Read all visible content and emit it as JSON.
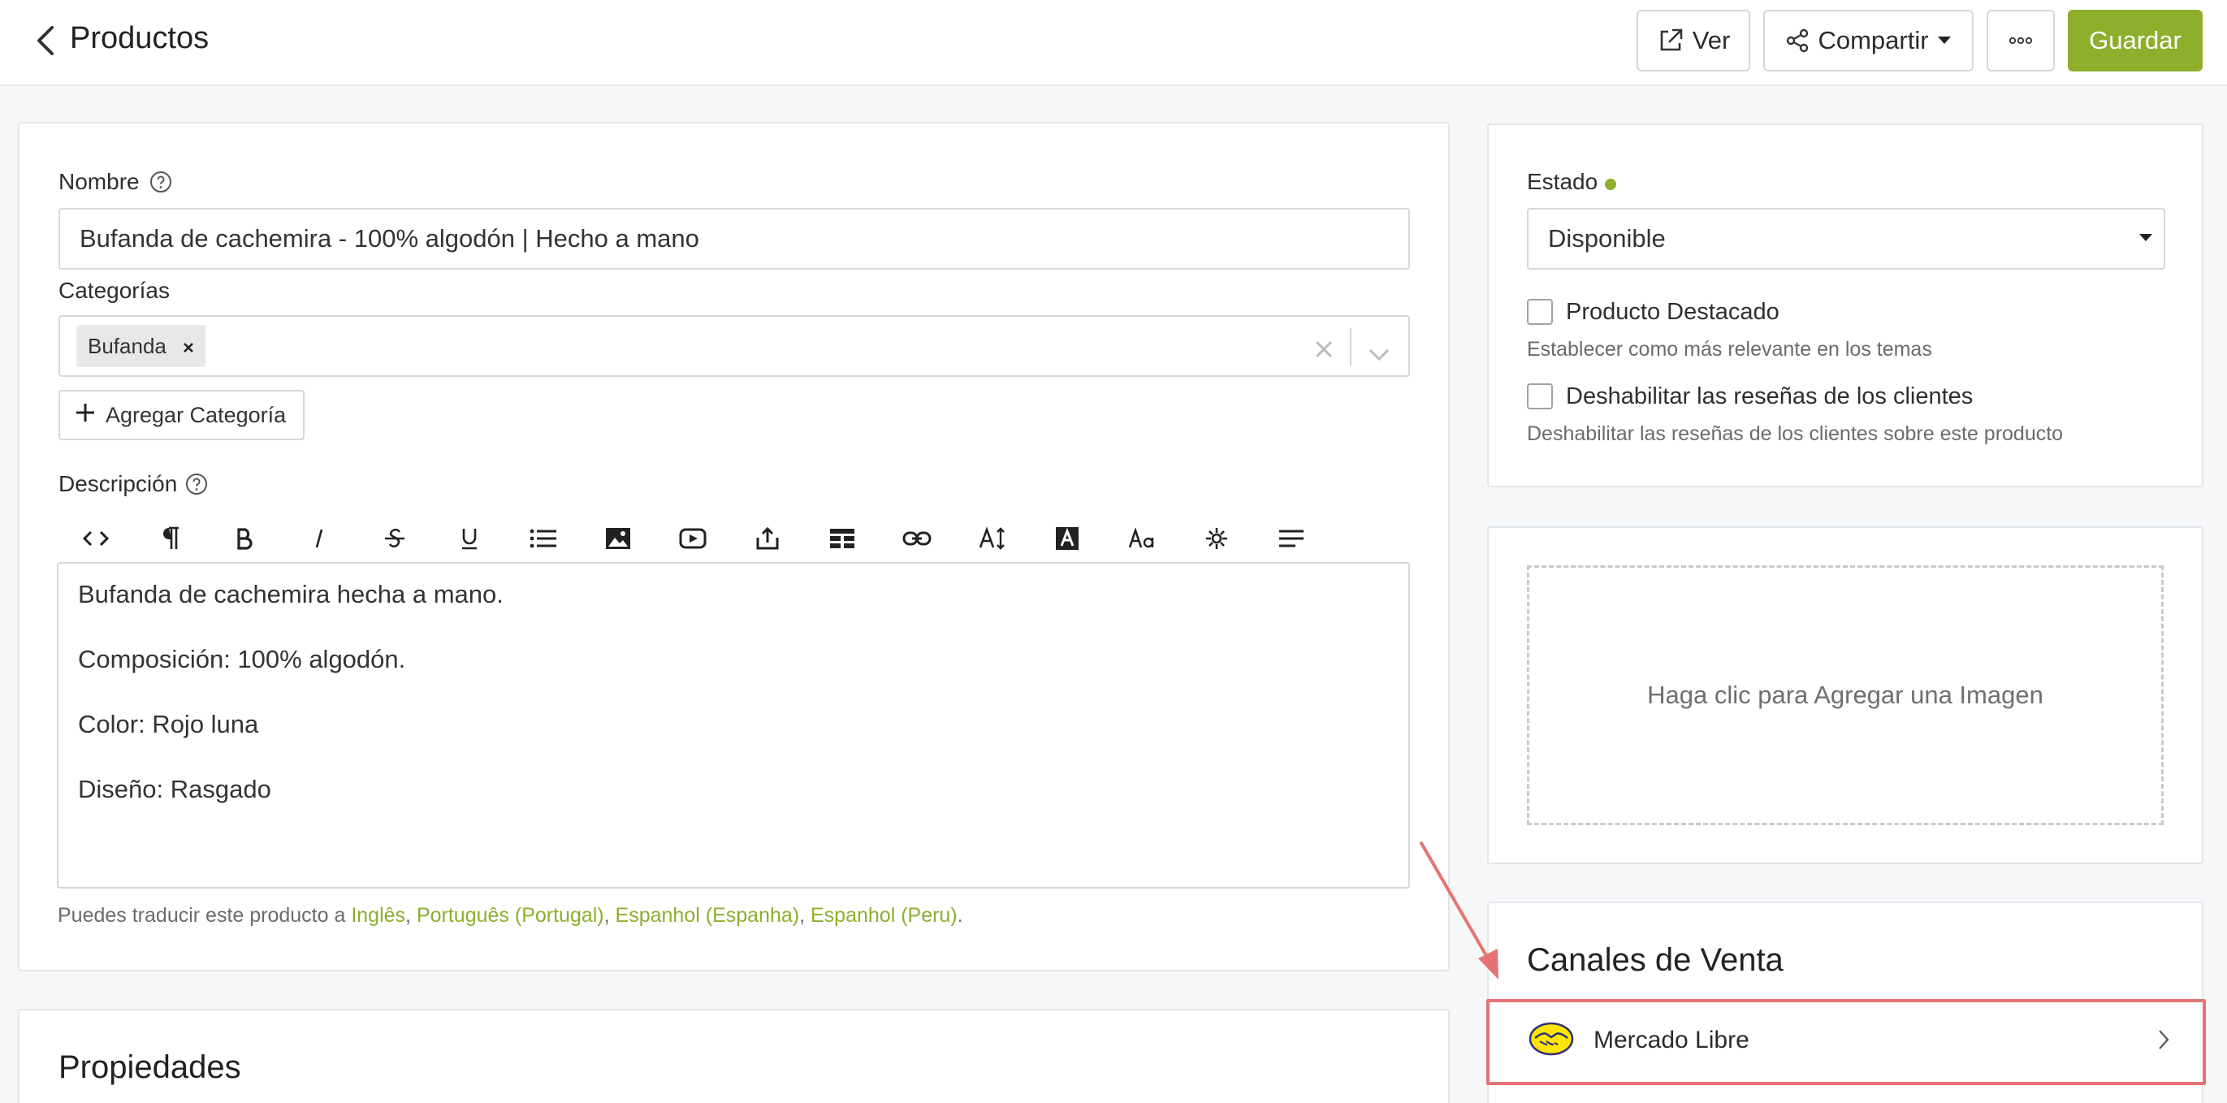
{
  "header": {
    "title": "Productos",
    "buttons": {
      "view": "Ver",
      "share": "Compartir",
      "save": "Guardar"
    }
  },
  "form": {
    "name_label": "Nombre",
    "name_value": "Bufanda de cachemira - 100% algodón | Hecho a mano",
    "categories_label": "Categorías",
    "categories": [
      "Bufanda"
    ],
    "add_category_label": "Agregar Categoría",
    "description_label": "Descripción",
    "description_lines": [
      "Bufanda de cachemira hecha a mano.",
      "Composición: 100% algodón.",
      "Color: Rojo luna",
      "Diseño: Rasgado"
    ],
    "translate_prefix": "Puedes traducir este producto a ",
    "translate_links": [
      "Inglês",
      "Português (Portugal)",
      "Espanhol (Espanha)",
      "Espanhol (Peru)"
    ]
  },
  "properties": {
    "title": "Propiedades"
  },
  "status": {
    "label": "Estado",
    "value": "Disponible",
    "indicator_color": "#8eae2c",
    "featured_label": "Producto Destacado",
    "featured_hint": "Establecer como más relevante en los temas",
    "featured_checked": false,
    "disable_reviews_label": "Deshabilitar las reseñas de los clientes",
    "disable_reviews_hint": "Deshabilitar las reseñas de los clientes sobre este producto",
    "disable_reviews_checked": false
  },
  "image_upload": {
    "prompt": "Haga clic para Agregar una Imagen"
  },
  "sales_channels": {
    "title": "Canales de Venta",
    "items": [
      {
        "label": "Mercado Libre",
        "icon": "mercado-libre-logo"
      }
    ]
  },
  "colors": {
    "accent": "#8eae2c",
    "highlight": "#e57373"
  },
  "toolbar_icons": [
    "code-icon",
    "paragraph-icon",
    "bold-icon",
    "italic-icon",
    "strikethrough-icon",
    "underline-icon",
    "list-icon",
    "image-icon",
    "video-icon",
    "upload-icon",
    "table-icon",
    "link-icon",
    "font-size-icon",
    "font-color-icon",
    "text-case-icon",
    "special-chars-icon",
    "align-icon"
  ]
}
